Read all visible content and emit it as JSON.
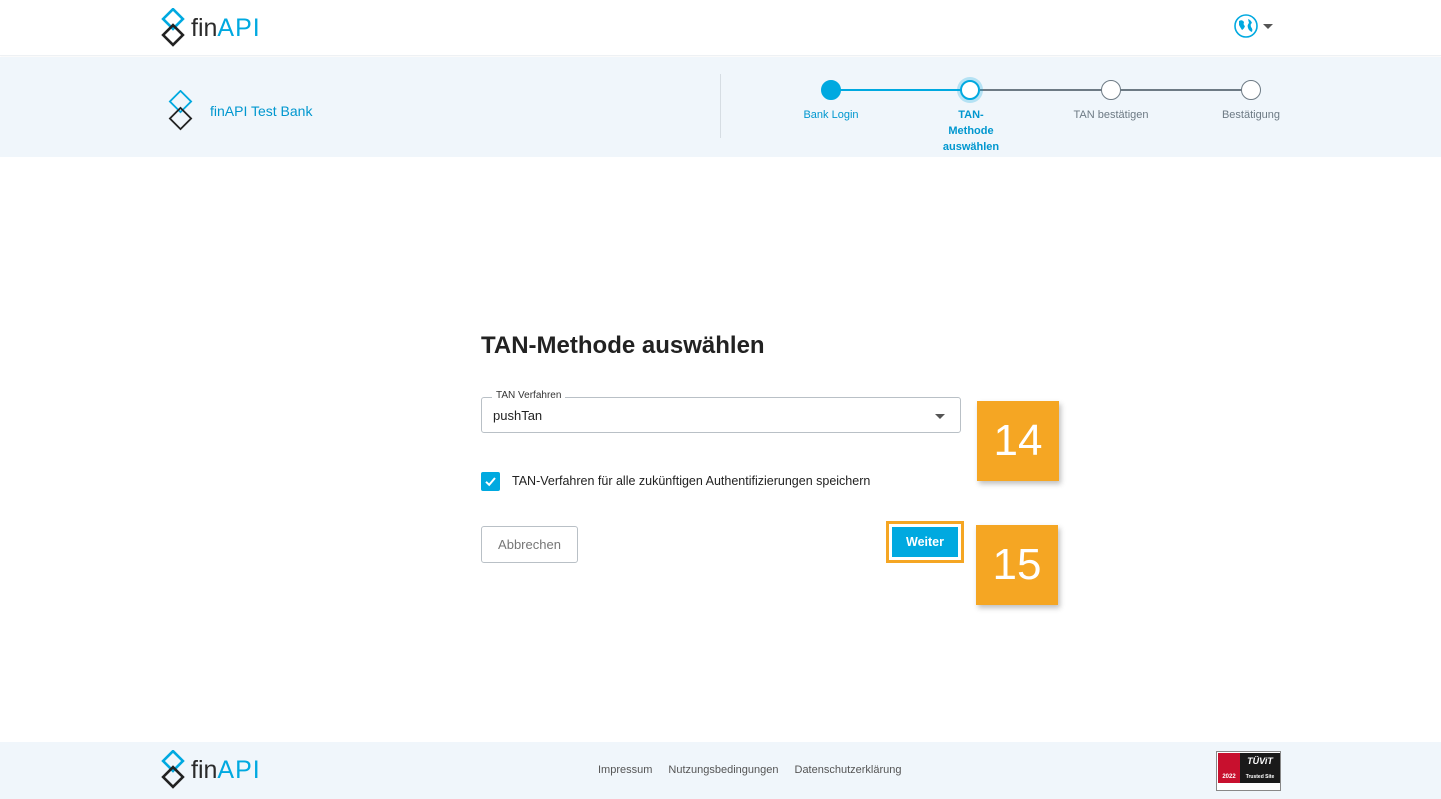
{
  "header": {
    "logo": {
      "fin": "fin",
      "api": "API"
    },
    "language_icon": "globe-icon"
  },
  "bank": {
    "name": "finAPI Test Bank",
    "icon": "finapi-diamond-icon"
  },
  "stepper": {
    "steps": [
      {
        "label": "Bank Login",
        "state": "done"
      },
      {
        "label": "TAN-Methode auswählen",
        "state": "active"
      },
      {
        "label": "TAN bestätigen",
        "state": "pending"
      },
      {
        "label": "Bestätigung",
        "state": "pending"
      }
    ]
  },
  "main": {
    "title": "TAN-Methode auswählen",
    "tan_field": {
      "label": "TAN Verfahren",
      "value": "pushTan"
    },
    "remember_checkbox": {
      "label": "TAN-Verfahren für alle zukünftigen Authentifizierungen speichern",
      "checked": true
    },
    "cancel_label": "Abbrechen",
    "next_label": "Weiter"
  },
  "annotations": {
    "badge_14": "14",
    "badge_15": "15"
  },
  "footer": {
    "logo": {
      "fin": "fin",
      "api": "API"
    },
    "links": [
      "Impressum",
      "Nutzungsbedingungen",
      "Datenschutzerklärung"
    ],
    "tuv": {
      "brand": "TÜViT",
      "subtitle": "Trusted Site",
      "year": "2022"
    }
  },
  "colors": {
    "accent": "#00a9e0",
    "highlight": "#f5a623",
    "strip_background": "#f0f6fb"
  }
}
